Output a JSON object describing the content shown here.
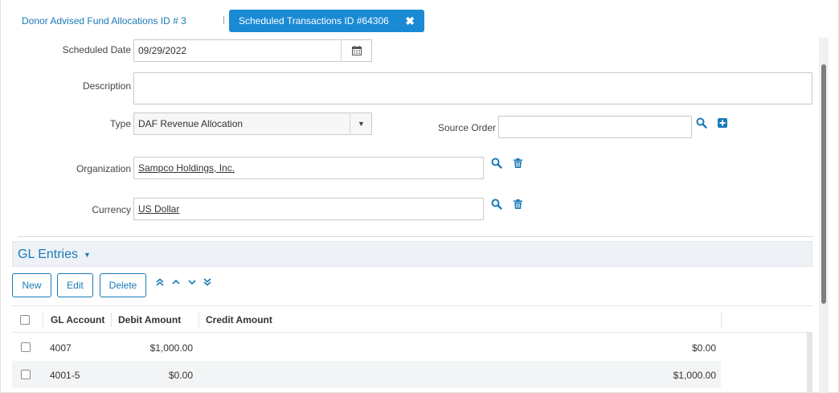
{
  "tabs": {
    "breadcrumb": "Donor Advised Fund Allocations ID # 3",
    "active": "Scheduled Transactions ID #64306",
    "close_icon": "close-icon"
  },
  "form": {
    "scheduled_date_label": "Scheduled Date",
    "scheduled_date_value": "09/29/2022",
    "description_label": "Description",
    "description_value": "",
    "type_label": "Type",
    "type_value": "DAF Revenue Allocation",
    "source_order_label": "Source Order",
    "source_order_value": "",
    "organization_label": "Organization",
    "organization_value": "Sampco Holdings, Inc.",
    "currency_label": "Currency",
    "currency_value": "US Dollar"
  },
  "gl_entries": {
    "title": "GL Entries",
    "buttons": {
      "new": "New",
      "edit": "Edit",
      "delete": "Delete"
    },
    "columns": [
      "GL Account",
      "Debit Amount",
      "Credit Amount"
    ],
    "rows": [
      {
        "account": "4007",
        "debit": "$1,000.00",
        "credit": "$0.00"
      },
      {
        "account": "4001-5",
        "debit": "$0.00",
        "credit": "$1,000.00"
      }
    ]
  },
  "colors": {
    "accent": "#1a8ad4",
    "link": "#1a7ab8"
  }
}
